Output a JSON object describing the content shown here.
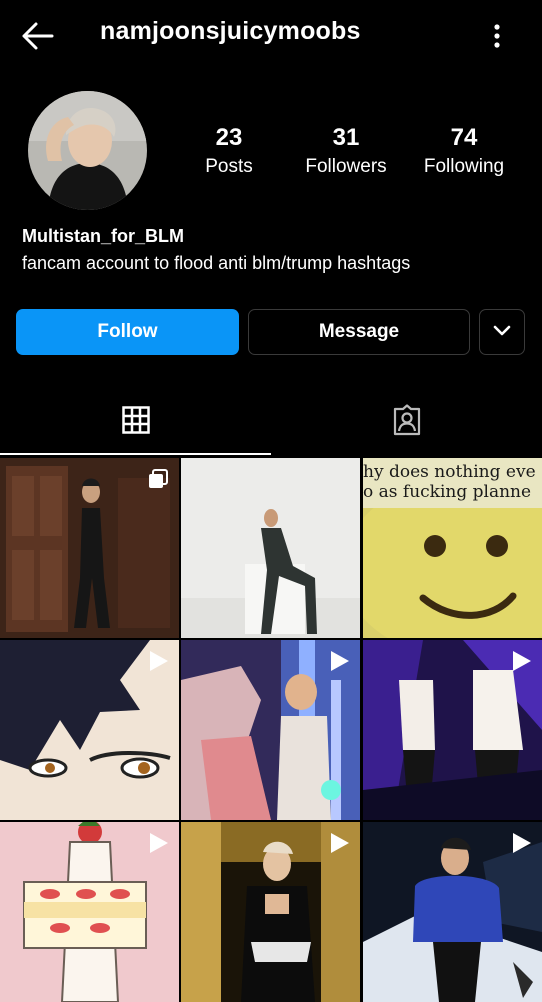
{
  "header": {
    "username": "namjoonsjuicymoobs",
    "back_icon": "arrow-left-icon",
    "menu_icon": "more-vertical-icon"
  },
  "profile": {
    "stats": [
      {
        "value": "23",
        "label": "Posts"
      },
      {
        "value": "31",
        "label": "Followers"
      },
      {
        "value": "74",
        "label": "Following"
      }
    ],
    "display_name": "Multistan_for_BLM",
    "bio": "fancam account to flood anti blm/trump hashtags"
  },
  "actions": {
    "follow_label": "Follow",
    "message_label": "Message",
    "follow_color": "#0a95f7"
  },
  "tabs": [
    {
      "name": "grid-tab",
      "icon": "grid-icon",
      "active": true
    },
    {
      "name": "tagged-tab",
      "icon": "tagged-person-icon",
      "active": false
    }
  ],
  "posts": {
    "meme_text_line1": "hy does nothing eve",
    "meme_text_line2": "o as fucking planne",
    "items": [
      {
        "type": "carousel"
      },
      {
        "type": "photo"
      },
      {
        "type": "photo"
      },
      {
        "type": "video"
      },
      {
        "type": "video"
      },
      {
        "type": "video"
      },
      {
        "type": "video"
      },
      {
        "type": "video"
      },
      {
        "type": "video"
      }
    ]
  }
}
